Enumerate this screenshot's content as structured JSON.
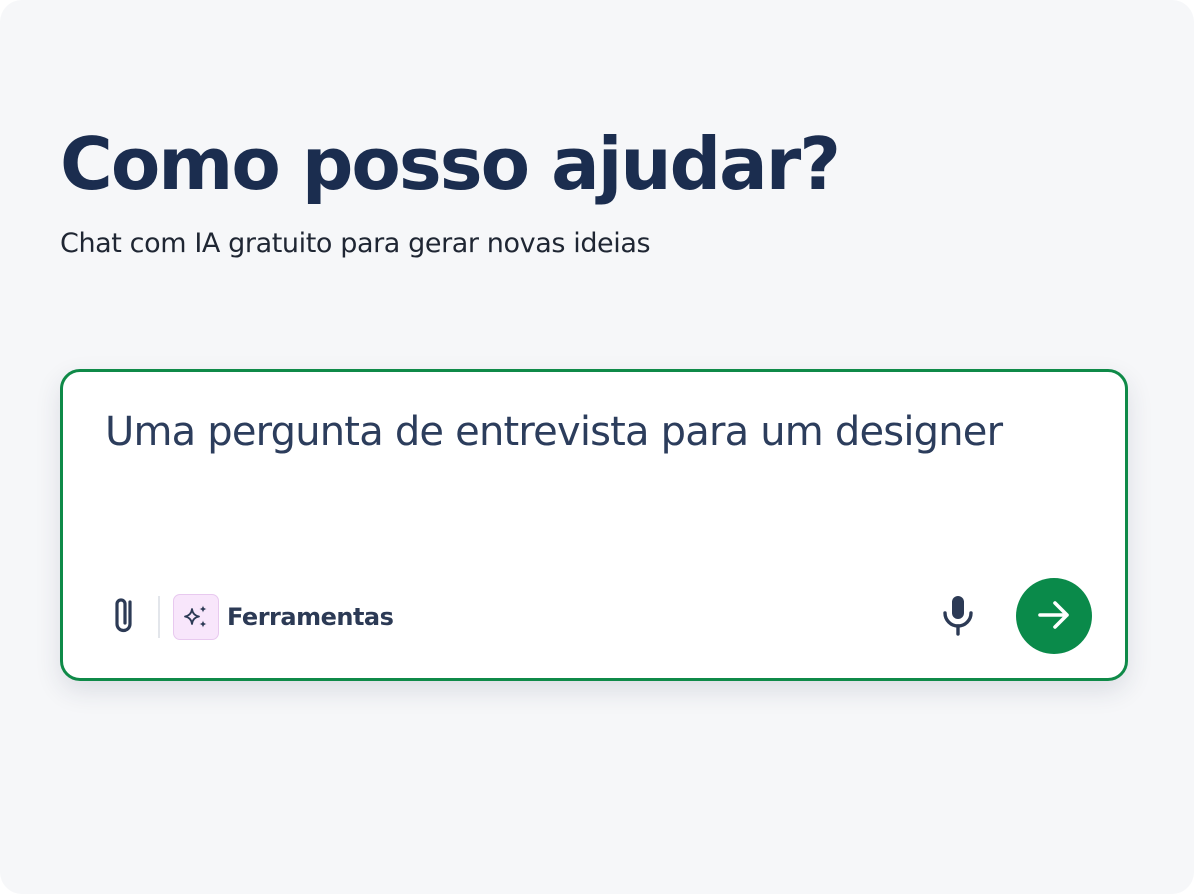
{
  "header": {
    "title": "Como posso ajudar?",
    "subtitle": "Chat com IA gratuito para gerar novas ideias"
  },
  "chat": {
    "placeholder": "Uma pergunta de entrevista para um designer",
    "value": "",
    "attach_icon": "paperclip-icon",
    "tools": {
      "label": "Ferramentas",
      "icon": "sparkles-icon"
    },
    "mic_icon": "microphone-icon",
    "send_icon": "arrow-right-icon"
  },
  "colors": {
    "background": "#f6f7f9",
    "title": "#1b2d4f",
    "accent_green": "#0a8a4a",
    "tools_badge_bg": "#f8e6fb"
  }
}
